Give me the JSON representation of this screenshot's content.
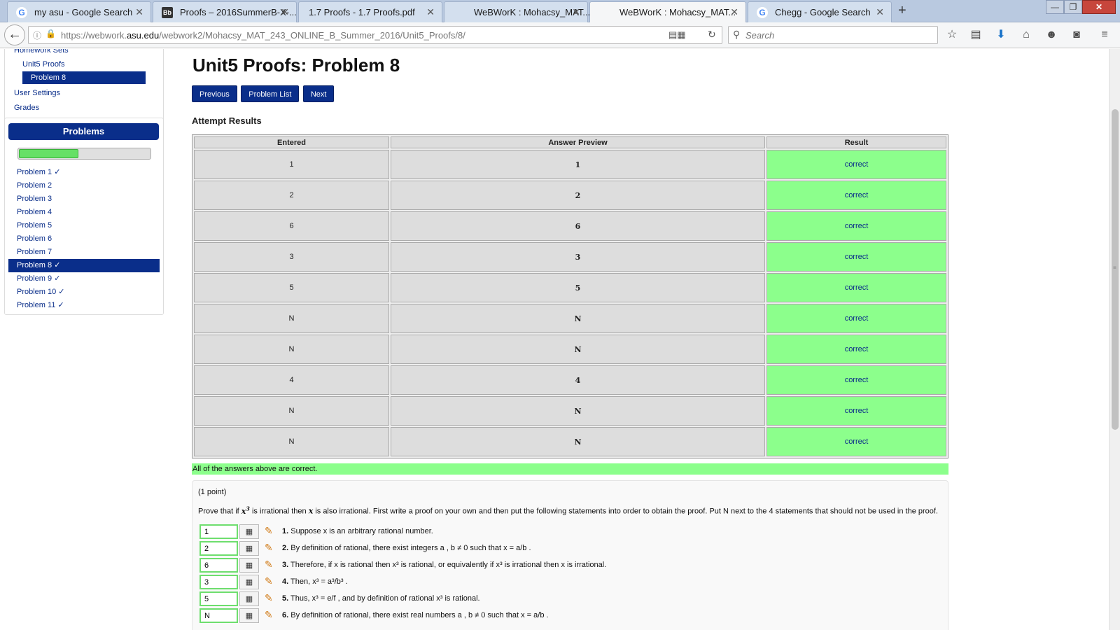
{
  "tabs": [
    {
      "title": "my asu - Google Search",
      "icon": "google"
    },
    {
      "title": "Proofs – 2016SummerB-X-...",
      "icon": "blackboard"
    },
    {
      "title": "1.7 Proofs - 1.7 Proofs.pdf",
      "icon": "pdf"
    },
    {
      "title": "WeBWorK : Mohacsy_MAT...",
      "icon": "webwork"
    },
    {
      "title": "WeBWorK : Mohacsy_MAT...",
      "icon": "webwork"
    },
    {
      "title": "Chegg - Google Search",
      "icon": "google"
    }
  ],
  "browser": {
    "url_prefix": "https://webwork.",
    "url_host": "asu.edu",
    "url_path": "/webwork2/Mohacsy_MAT_243_ONLINE_B_Summer_2016/Unit5_Proofs/8/",
    "search_placeholder": "Search"
  },
  "sidebar": {
    "homework_sets": "Homework Sets",
    "set_name": "Unit5 Proofs",
    "current_problem": "Problem 8",
    "user_settings": "User Settings",
    "grades": "Grades",
    "problems_header": "Problems",
    "progress_fraction": 0.45,
    "problems": [
      "Problem 1 ✓",
      "Problem 2",
      "Problem 3",
      "Problem 4",
      "Problem 5",
      "Problem 6",
      "Problem 7",
      "Problem 8 ✓",
      "Problem 9 ✓",
      "Problem 10 ✓",
      "Problem 11 ✓"
    ]
  },
  "main": {
    "title": "Unit5 Proofs: Problem 8",
    "buttons": {
      "previous": "Previous",
      "problem_list": "Problem List",
      "next": "Next"
    },
    "attempt_results": "Attempt Results",
    "table_headers": [
      "Entered",
      "Answer Preview",
      "Result"
    ],
    "rows": [
      {
        "entered": "1",
        "preview": "1",
        "result": "correct"
      },
      {
        "entered": "2",
        "preview": "2",
        "result": "correct"
      },
      {
        "entered": "6",
        "preview": "6",
        "result": "correct"
      },
      {
        "entered": "3",
        "preview": "3",
        "result": "correct"
      },
      {
        "entered": "5",
        "preview": "5",
        "result": "correct"
      },
      {
        "entered": "N",
        "preview": "N",
        "result": "correct"
      },
      {
        "entered": "N",
        "preview": "N",
        "result": "correct"
      },
      {
        "entered": "4",
        "preview": "4",
        "result": "correct"
      },
      {
        "entered": "N",
        "preview": "N",
        "result": "correct"
      },
      {
        "entered": "N",
        "preview": "N",
        "result": "correct"
      }
    ],
    "all_correct": "All of the answers above are correct.",
    "points": "(1 point)",
    "prompt_a": "Prove that if",
    "prompt_b": "is irrational then",
    "prompt_c": "is also irrational. First write a proof on your own and then put the following statements into order to obtain the proof. Put N next to the 4 statements that should not be used in the proof.",
    "statements": [
      {
        "answer": "1",
        "num": "1.",
        "text": "Suppose x is an arbitrary rational number."
      },
      {
        "answer": "2",
        "num": "2.",
        "text": "By definition of rational, there exist integers a , b ≠ 0 such that x = a/b ."
      },
      {
        "answer": "6",
        "num": "3.",
        "text": "Therefore, if x is rational then x³ is rational, or equivalently if x³ is irrational then x is irrational."
      },
      {
        "answer": "3",
        "num": "4.",
        "text": "Then, x³ = a³/b³ ."
      },
      {
        "answer": "5",
        "num": "5.",
        "text": "Thus, x³ = e/f , and by definition of rational x³ is rational."
      },
      {
        "answer": "N",
        "num": "6.",
        "text": "By definition of rational, there exist real numbers a , b ≠ 0 such that x = a/b ."
      }
    ]
  }
}
